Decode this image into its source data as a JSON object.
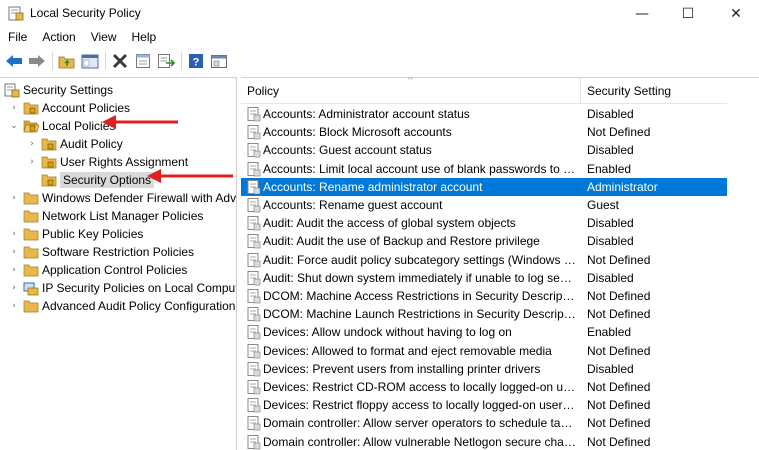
{
  "window": {
    "title": "Local Security Policy",
    "minimize_glyph": "—",
    "maximize_glyph": "☐",
    "close_glyph": "✕"
  },
  "menu": [
    "File",
    "Action",
    "View",
    "Help"
  ],
  "toolbar": {
    "icons": [
      "back-arrow-icon",
      "forward-arrow-icon",
      "up-folder-icon",
      "show-hide-tree-icon",
      "delete-icon",
      "properties-icon",
      "export-list-icon",
      "help-icon",
      "console-icon"
    ]
  },
  "tree": {
    "root": "Security Settings",
    "items": [
      {
        "label": "Account Policies",
        "level": 1,
        "expand": "›"
      },
      {
        "label": "Local Policies",
        "level": 1,
        "expand": "⌄"
      },
      {
        "label": "Audit Policy",
        "level": 2,
        "expand": "›"
      },
      {
        "label": "User Rights Assignment",
        "level": 2,
        "expand": "›"
      },
      {
        "label": "Security Options",
        "level": 2,
        "expand": ""
      },
      {
        "label": "Windows Defender Firewall with Advanced Security",
        "level": 1,
        "expand": "›"
      },
      {
        "label": "Network List Manager Policies",
        "level": 1,
        "expand": ""
      },
      {
        "label": "Public Key Policies",
        "level": 1,
        "expand": "›"
      },
      {
        "label": "Software Restriction Policies",
        "level": 1,
        "expand": "›"
      },
      {
        "label": "Application Control Policies",
        "level": 1,
        "expand": "›"
      },
      {
        "label": "IP Security Policies on Local Computer",
        "level": 1,
        "expand": "›"
      },
      {
        "label": "Advanced Audit Policy Configuration",
        "level": 1,
        "expand": "›"
      }
    ]
  },
  "list": {
    "sort_arrow": "^",
    "columns": {
      "policy": "Policy",
      "setting": "Security Setting"
    },
    "rows": [
      {
        "policy": "Accounts: Administrator account status",
        "setting": "Disabled"
      },
      {
        "policy": "Accounts: Block Microsoft accounts",
        "setting": "Not Defined"
      },
      {
        "policy": "Accounts: Guest account status",
        "setting": "Disabled"
      },
      {
        "policy": "Accounts: Limit local account use of blank passwords to console logon only",
        "setting": "Enabled"
      },
      {
        "policy": "Accounts: Rename administrator account",
        "setting": "Administrator"
      },
      {
        "policy": "Accounts: Rename guest account",
        "setting": "Guest"
      },
      {
        "policy": "Audit: Audit the access of global system objects",
        "setting": "Disabled"
      },
      {
        "policy": "Audit: Audit the use of Backup and Restore privilege",
        "setting": "Disabled"
      },
      {
        "policy": "Audit: Force audit policy subcategory settings (Windows Vista or later)",
        "setting": "Not Defined"
      },
      {
        "policy": "Audit: Shut down system immediately if unable to log security audits",
        "setting": "Disabled"
      },
      {
        "policy": "DCOM: Machine Access Restrictions in Security Descriptor Definition Language",
        "setting": "Not Defined"
      },
      {
        "policy": "DCOM: Machine Launch Restrictions in Security Descriptor Definition Language",
        "setting": "Not Defined"
      },
      {
        "policy": "Devices: Allow undock without having to log on",
        "setting": "Enabled"
      },
      {
        "policy": "Devices: Allowed to format and eject removable media",
        "setting": "Not Defined"
      },
      {
        "policy": "Devices: Prevent users from installing printer drivers",
        "setting": "Disabled"
      },
      {
        "policy": "Devices: Restrict CD-ROM access to locally logged-on user only",
        "setting": "Not Defined"
      },
      {
        "policy": "Devices: Restrict floppy access to locally logged-on user only",
        "setting": "Not Defined"
      },
      {
        "policy": "Domain controller: Allow server operators to schedule tasks",
        "setting": "Not Defined"
      },
      {
        "policy": "Domain controller: Allow vulnerable Netlogon secure channel connections",
        "setting": "Not Defined"
      }
    ],
    "selected_row": 4
  },
  "colors": {
    "selection": "#0078d7",
    "tree_selection": "#d9d9d9",
    "annotation_arrow": "#e02020",
    "folder": "#e8b84a"
  }
}
